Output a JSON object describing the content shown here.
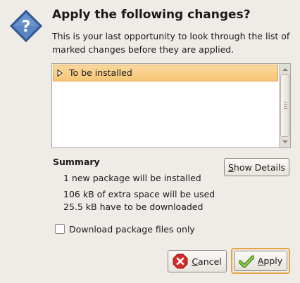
{
  "dialog": {
    "title": "Apply the following changes?",
    "message": "This is your last opportunity to look through the list of marked changes before they are applied.",
    "icon": "question-icon"
  },
  "changes_list": {
    "rows": [
      {
        "label": "To be installed",
        "expanded": false,
        "selected": true
      }
    ]
  },
  "summary": {
    "heading": "Summary",
    "lines": [
      "1 new package will be installed",
      "106 kB of extra space will be used",
      "25.5 kB have to be downloaded"
    ]
  },
  "buttons": {
    "show_details_mnemonic": "S",
    "show_details_rest": "how Details",
    "cancel_mnemonic": "C",
    "cancel_rest": "ancel",
    "apply_mnemonic": "A",
    "apply_rest": "pply"
  },
  "options": {
    "download_only_label": "Download package files only",
    "download_only_checked": false
  },
  "colors": {
    "accent": "#f7c676",
    "focus": "#e6a447",
    "background": "#efebe7"
  }
}
